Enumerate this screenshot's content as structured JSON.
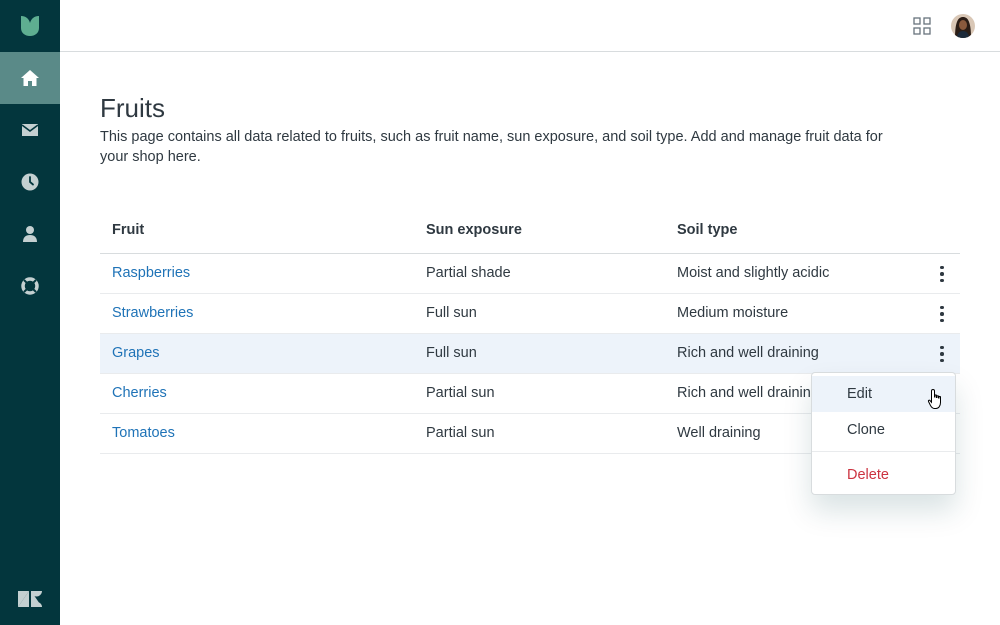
{
  "colors": {
    "sidebar_bg": "#03363d",
    "sidebar_active": "#5a8a88",
    "brand_green": "#78a300",
    "link": "#1f73b7",
    "danger": "#cc3340",
    "row_hover": "#edf3fa"
  },
  "sidebar": {
    "logo_icon": "leaf-logo-icon",
    "items": [
      {
        "icon": "home-icon",
        "active": true
      },
      {
        "icon": "mail-icon",
        "active": false
      },
      {
        "icon": "clock-icon",
        "active": false
      },
      {
        "icon": "person-icon",
        "active": false
      },
      {
        "icon": "lifebuoy-icon",
        "active": false
      }
    ],
    "footer_icon": "zendesk-logo-icon"
  },
  "header": {
    "apps_icon": "grid-icon",
    "avatar_icon": "avatar"
  },
  "main": {
    "title": "Fruits",
    "description": "This page contains all data related to fruits, such as fruit name, sun exposure, and soil type. Add and manage fruit data for your shop here."
  },
  "table": {
    "headers": [
      "Fruit",
      "Sun exposure",
      "Soil type"
    ],
    "rows": [
      {
        "fruit": "Raspberries",
        "sun": "Partial shade",
        "soil": "Moist and slightly acidic"
      },
      {
        "fruit": "Strawberries",
        "sun": "Full sun",
        "soil": "Medium moisture"
      },
      {
        "fruit": "Grapes",
        "sun": "Full sun",
        "soil": "Rich and well draining"
      },
      {
        "fruit": "Cherries",
        "sun": "Partial sun",
        "soil": "Rich and well draining"
      },
      {
        "fruit": "Tomatoes",
        "sun": "Partial sun",
        "soil": "Well draining"
      }
    ]
  },
  "menu": {
    "items": [
      {
        "label": "Edit"
      },
      {
        "label": "Clone"
      },
      {
        "label": "Delete"
      }
    ]
  }
}
